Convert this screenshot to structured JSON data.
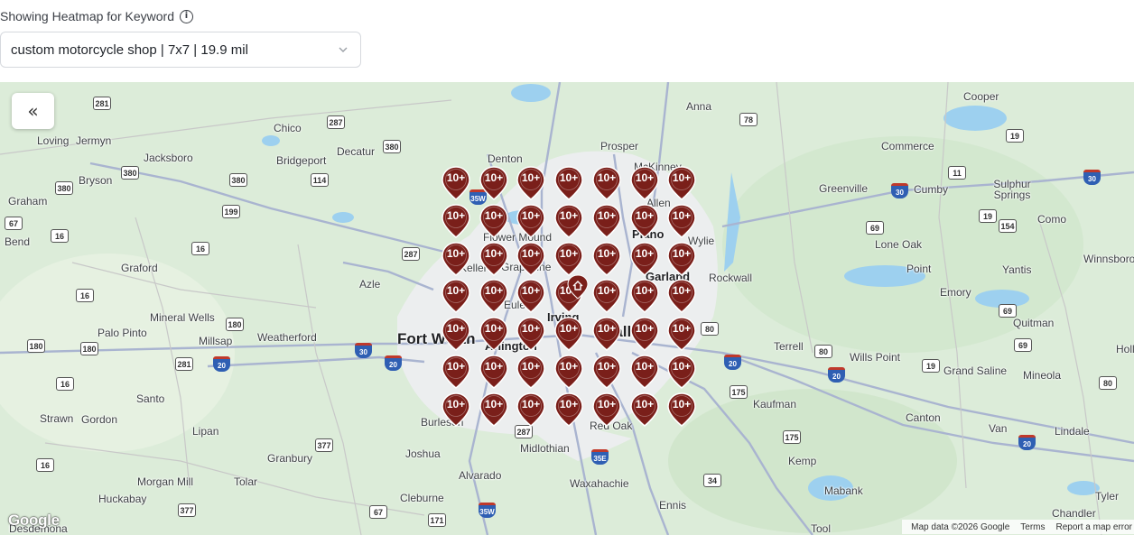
{
  "header": {
    "title": "Showing Heatmap for Keyword",
    "info_icon": "info-icon",
    "selected_keyword": "custom motorcycle shop | 7x7 | 19.9 mil"
  },
  "map": {
    "collapse_label": "«",
    "google_logo": "Google",
    "attribution": {
      "map_data": "Map data ©2026 Google",
      "terms": "Terms",
      "report": "Report a map error"
    },
    "grid": {
      "rows": 7,
      "cols": 7,
      "rank_label": "10+",
      "pin_color": "#7a1f1a"
    },
    "business_pin_icon": "home-icon",
    "cities": [
      "Loving",
      "Jermyn",
      "Chico",
      "Decatur",
      "Denton",
      "Prosper",
      "Anna",
      "Cooper",
      "Jacksboro",
      "Bridgeport",
      "McKinney",
      "Commerce",
      "Graham",
      "Bryson",
      "Allen",
      "Greenville",
      "Cumby",
      "Sulphur Springs",
      "Flower Mound",
      "Plano",
      "Wylie",
      "Lone Oak",
      "Como",
      "Bend",
      "Graford",
      "Keller",
      "Grapevine",
      "Garland",
      "Rockwall",
      "Point",
      "Yantis",
      "Winnsboro",
      "Azle",
      "Euless",
      "Emory",
      "Mineral Wells",
      "Irving",
      "Quitman",
      "Palo Pinto",
      "Millsap",
      "Weatherford",
      "Fort Worth",
      "Arlington",
      "Terrell",
      "Wills Point",
      "Holly",
      "Grand Saline",
      "Mineola",
      "Santo",
      "Kaufman",
      "Strawn",
      "Gordon",
      "Burleson",
      "Red Oak",
      "Canton",
      "Van",
      "Lindale",
      "Lipan",
      "Joshua",
      "Midlothian",
      "Granbury",
      "Kemp",
      "Alvarado",
      "Waxahachie",
      "Morgan Mill",
      "Tolar",
      "Mabank",
      "Huckabay",
      "Cleburne",
      "Ennis",
      "Chandler",
      "Tyler",
      "Tool",
      "Desdemona",
      "Dallas"
    ]
  }
}
